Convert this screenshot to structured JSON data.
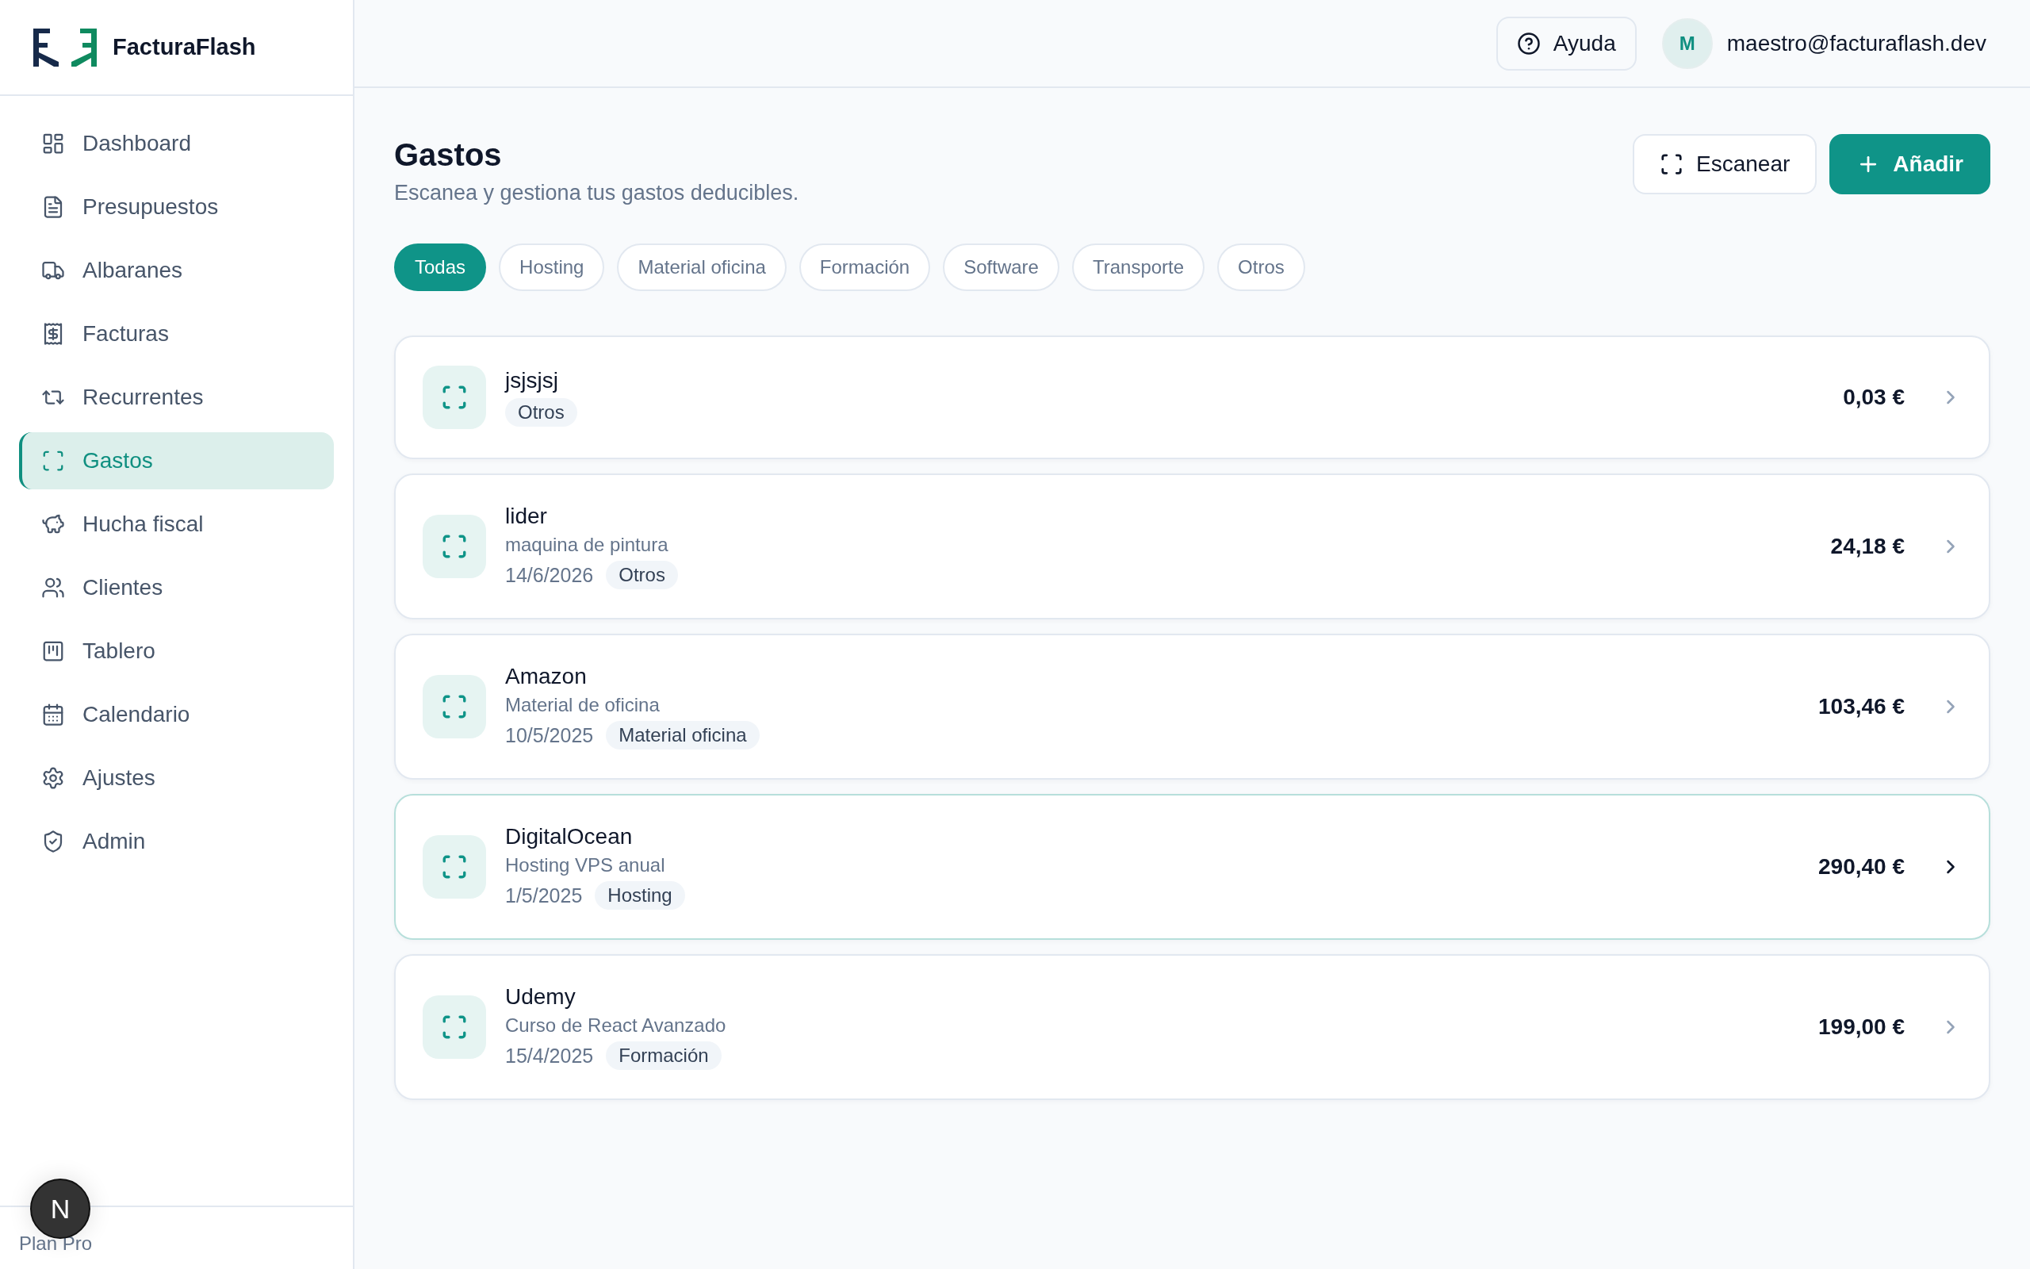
{
  "brand": {
    "name": "FacturaFlash"
  },
  "sidebar": {
    "items": [
      {
        "label": "Dashboard",
        "selected": false
      },
      {
        "label": "Presupuestos",
        "selected": false
      },
      {
        "label": "Albaranes",
        "selected": false
      },
      {
        "label": "Facturas",
        "selected": false
      },
      {
        "label": "Recurrentes",
        "selected": false
      },
      {
        "label": "Gastos",
        "selected": true
      },
      {
        "label": "Hucha fiscal",
        "selected": false
      },
      {
        "label": "Clientes",
        "selected": false
      },
      {
        "label": "Tablero",
        "selected": false
      },
      {
        "label": "Calendario",
        "selected": false
      },
      {
        "label": "Ajustes",
        "selected": false
      },
      {
        "label": "Admin",
        "selected": false
      }
    ],
    "footer": "Plan Pro"
  },
  "dev_badge": "N",
  "topbar": {
    "help": "Ayuda",
    "avatar": "M",
    "email": "maestro@facturaflash.dev"
  },
  "page": {
    "title": "Gastos",
    "subtitle": "Escanea y gestiona tus gastos deducibles.",
    "buttons": [
      {
        "label": "Escanear",
        "kind": "secondary"
      },
      {
        "label": "Añadir",
        "kind": "primary"
      }
    ]
  },
  "filters": [
    {
      "label": "Todas",
      "selected": true
    },
    {
      "label": "Hosting",
      "selected": false
    },
    {
      "label": "Material oficina",
      "selected": false
    },
    {
      "label": "Formación",
      "selected": false
    },
    {
      "label": "Software",
      "selected": false
    },
    {
      "label": "Transporte",
      "selected": false
    },
    {
      "label": "Otros",
      "selected": false
    }
  ],
  "expenses": [
    {
      "name": "jsjsjsj",
      "category": "Otros",
      "amount": "0,03 €",
      "selected": false
    },
    {
      "name": "lider",
      "description": "maquina de pintura",
      "date": "14/6/2026",
      "category": "Otros",
      "amount": "24,18 €",
      "selected": false
    },
    {
      "name": "Amazon",
      "description": "Material de oficina",
      "date": "10/5/2025",
      "category": "Material oficina",
      "amount": "103,46 €",
      "selected": false
    },
    {
      "name": "DigitalOcean",
      "description": "Hosting VPS anual",
      "date": "1/5/2025",
      "category": "Hosting",
      "amount": "290,40 €",
      "selected": true
    },
    {
      "name": "Udemy",
      "description": "Curso de React Avanzado",
      "date": "15/4/2025",
      "category": "Formación",
      "amount": "199,00 €",
      "selected": false
    }
  ]
}
